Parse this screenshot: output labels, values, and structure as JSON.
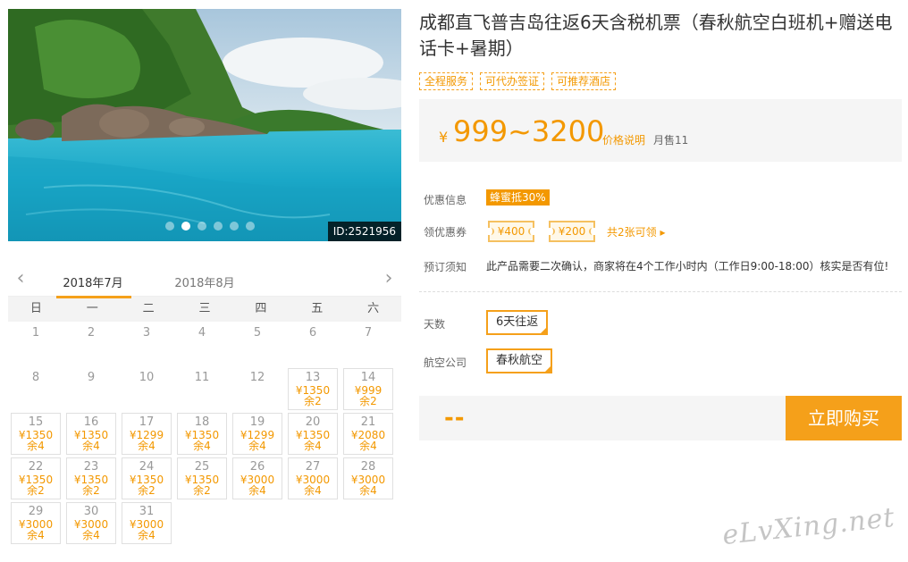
{
  "hero": {
    "image_id": "ID:2521956",
    "dots": [
      false,
      true,
      false,
      false,
      false,
      false
    ]
  },
  "calendar": {
    "months": [
      "2018年7月",
      "2018年8月"
    ],
    "weekdays": [
      "日",
      "一",
      "二",
      "三",
      "四",
      "五",
      "六"
    ],
    "days": [
      {
        "d": "1"
      },
      {
        "d": "2"
      },
      {
        "d": "3"
      },
      {
        "d": "4"
      },
      {
        "d": "5"
      },
      {
        "d": "6"
      },
      {
        "d": "7"
      },
      {
        "d": "8"
      },
      {
        "d": "9"
      },
      {
        "d": "10"
      },
      {
        "d": "11"
      },
      {
        "d": "12"
      },
      {
        "d": "13",
        "price": "¥1350",
        "stock": "余2"
      },
      {
        "d": "14",
        "price": "¥999",
        "stock": "余2"
      },
      {
        "d": "15",
        "price": "¥1350",
        "stock": "余4"
      },
      {
        "d": "16",
        "price": "¥1350",
        "stock": "余4"
      },
      {
        "d": "17",
        "price": "¥1299",
        "stock": "余4"
      },
      {
        "d": "18",
        "price": "¥1350",
        "stock": "余4"
      },
      {
        "d": "19",
        "price": "¥1299",
        "stock": "余4"
      },
      {
        "d": "20",
        "price": "¥1350",
        "stock": "余4"
      },
      {
        "d": "21",
        "price": "¥2080",
        "stock": "余4"
      },
      {
        "d": "22",
        "price": "¥1350",
        "stock": "余2"
      },
      {
        "d": "23",
        "price": "¥1350",
        "stock": "余2"
      },
      {
        "d": "24",
        "price": "¥1350",
        "stock": "余2"
      },
      {
        "d": "25",
        "price": "¥1350",
        "stock": "余2"
      },
      {
        "d": "26",
        "price": "¥3000",
        "stock": "余4"
      },
      {
        "d": "27",
        "price": "¥3000",
        "stock": "余4"
      },
      {
        "d": "28",
        "price": "¥3000",
        "stock": "余4"
      },
      {
        "d": "29",
        "price": "¥3000",
        "stock": "余4"
      },
      {
        "d": "30",
        "price": "¥3000",
        "stock": "余4"
      },
      {
        "d": "31",
        "price": "¥3000",
        "stock": "余4"
      }
    ]
  },
  "product": {
    "title": "成都直飞普吉岛往返6天含税机票（春秋航空白班机+赠送电话卡+暑期）",
    "tags": [
      "全程服务",
      "可代办签证",
      "可推荐酒店"
    ],
    "price_currency": "¥",
    "price_range": "999~3200",
    "price_note": "价格说明",
    "monthly_sales": "月售11"
  },
  "offers": {
    "promo_label": "优惠信息",
    "promo_badge": "蜂蜜抵30%",
    "coupon_label": "领优惠券",
    "coupons": [
      "¥400",
      "¥200"
    ],
    "coupon_count": "共2张可领 ▸",
    "booking_label": "预订须知",
    "booking_text": "此产品需要二次确认，商家将在4个工作小时内（工作日9:00-18:00）核实是否有位!"
  },
  "options": {
    "days_label": "天数",
    "days_value": "6天往返",
    "airline_label": "航空公司",
    "airline_value": "春秋航空"
  },
  "buy": {
    "total": "--",
    "button": "立即购买"
  },
  "watermark": "eLvXing.net"
}
